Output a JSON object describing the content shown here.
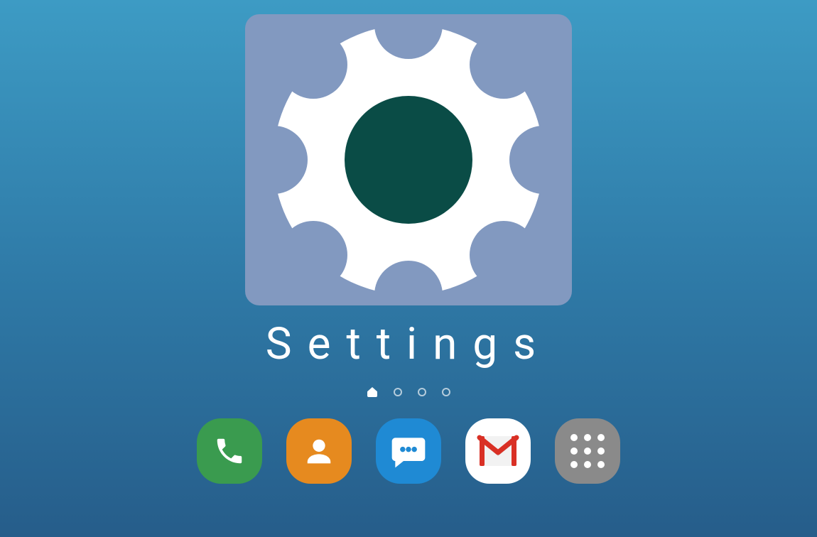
{
  "featuredApp": {
    "label": "Settings",
    "icon": "settings-gear"
  },
  "pageIndicators": {
    "total": 4,
    "activeIndex": 0,
    "firstIsHome": true
  },
  "dock": {
    "items": [
      {
        "name": "phone",
        "label": "Phone",
        "color": "#3a9b4f"
      },
      {
        "name": "contacts",
        "label": "Contacts",
        "color": "#e68a1f"
      },
      {
        "name": "messages",
        "label": "Messages",
        "color": "#1f8ad4"
      },
      {
        "name": "gmail",
        "label": "Gmail",
        "color": "#ffffff"
      },
      {
        "name": "apps",
        "label": "Apps",
        "color": "#8a8a8a"
      }
    ]
  },
  "colors": {
    "backgroundTop": "#3d9bc4",
    "backgroundBottom": "#265d8a",
    "tileBackground": "#8299c0",
    "gearCenter": "#0a4c46",
    "gearBody": "#ffffff"
  }
}
